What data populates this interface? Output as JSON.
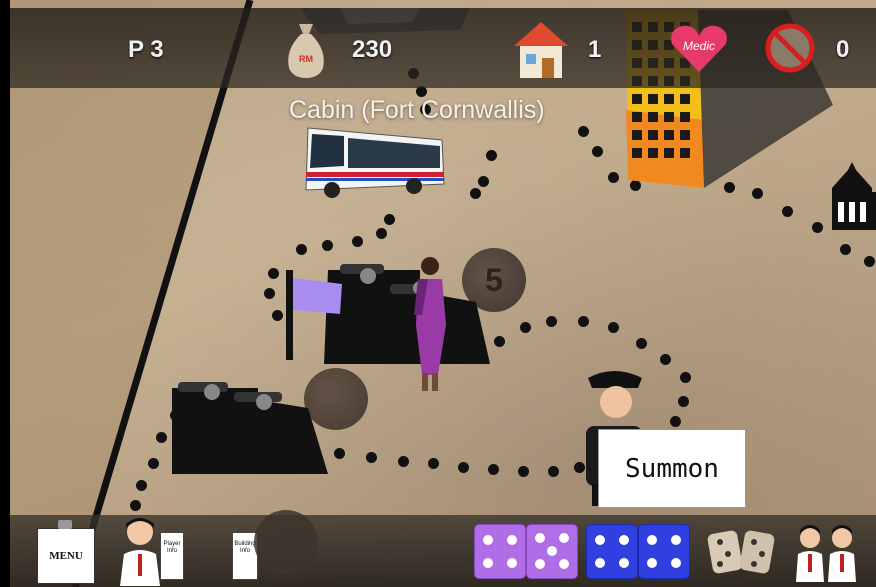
{
  "hud": {
    "player_label": "P 3",
    "money_value": "230",
    "money_bag_text": "RM",
    "houses_value": "1",
    "medic_text": "Medic",
    "blocked_value": "0"
  },
  "location_label": "Cabin (Fort Cornwallis)",
  "board": {
    "space_5_label": "5",
    "summon_label": "Summon"
  },
  "bottom": {
    "menu_label": "MENU",
    "card_1_text": "Player Info",
    "card_2_text": "Building Info",
    "dice_purple": [
      4,
      5
    ],
    "dice_blue": [
      4,
      4
    ]
  },
  "colors": {
    "purple_die": "#b06ee6",
    "blue_die": "#2f3fe0",
    "flag": "#a98cf0",
    "ground": "#c2ab8b",
    "hud_bar": "#2a2620"
  },
  "icons": [
    "money-bag-icon",
    "house-icon",
    "medic-heart-icon",
    "no-entry-icon",
    "building-icon",
    "temple-icon",
    "bus-icon",
    "woman-figure-icon",
    "police-officer-icon",
    "cannon-fort-icon",
    "flag-icon",
    "menu-clipboard-icon",
    "players-icon",
    "dice-roll-icon"
  ]
}
